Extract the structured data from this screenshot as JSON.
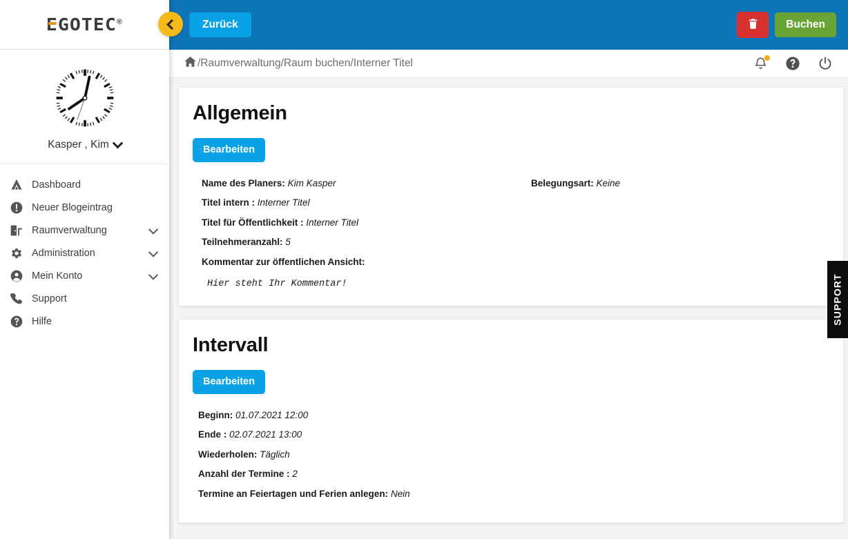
{
  "brand": {
    "logo_text": "EGOTEC",
    "logo_registered": "®",
    "accent_orange": "#e8931f",
    "header_blue": "#0e75b8",
    "button_blue": "#0aa2e6",
    "green": "#68a536",
    "red": "#d9312f",
    "yellow": "#f5ba17"
  },
  "header": {
    "back_circle_icon": "chevron-left-icon",
    "back_label": "Zurück",
    "delete_icon": "trash-icon",
    "book_label": "Buchen"
  },
  "breadcrumb": {
    "home_icon": "home-icon",
    "path": "/Raumverwaltung/Raum buchen/Interner Titel",
    "icons": [
      {
        "name": "bell-icon",
        "has_dot": true
      },
      {
        "name": "help-circle-icon",
        "has_dot": false
      },
      {
        "name": "power-icon",
        "has_dot": false
      }
    ]
  },
  "sidebar": {
    "profile": {
      "avatar_icon": "analog-clock-avatar",
      "name": "Kasper , Kim",
      "chevron_icon": "chevron-down-icon"
    },
    "items": [
      {
        "label": "Dashboard",
        "icon": "dashboard-tent-icon",
        "expandable": false
      },
      {
        "label": "Neuer Blogeintrag",
        "icon": "exclamation-circle-icon",
        "expandable": false
      },
      {
        "label": "Raumverwaltung",
        "icon": "room-door-icon",
        "expandable": true
      },
      {
        "label": "Administration",
        "icon": "gear-icon",
        "expandable": true
      },
      {
        "label": "Mein Konto",
        "icon": "user-circle-icon",
        "expandable": true
      },
      {
        "label": "Support",
        "icon": "phone-icon",
        "expandable": false
      },
      {
        "label": "Hilfe",
        "icon": "question-circle-icon",
        "expandable": false
      }
    ]
  },
  "support_tab": {
    "label": "SUPPORT"
  },
  "cards": {
    "allgemein": {
      "title": "Allgemein",
      "edit_label": "Bearbeiten",
      "left_fields": [
        {
          "label": "Name des Planers:",
          "value": "Kim Kasper"
        },
        {
          "label": "Titel intern :",
          "value": "Interner Titel"
        },
        {
          "label": "Titel für Öffentlichkeit :",
          "value": "Interner Titel"
        },
        {
          "label": "Teilnehmeranzahl:",
          "value": "5"
        }
      ],
      "comment_label": "Kommentar zur öffentlichen Ansicht:",
      "comment_value": "Hier steht Ihr Kommentar!",
      "right_fields": [
        {
          "label": "Belegungsart:",
          "value": "Keine"
        }
      ]
    },
    "intervall": {
      "title": "Intervall",
      "edit_label": "Bearbeiten",
      "fields": [
        {
          "label": "Beginn:",
          "value": "01.07.2021 12:00"
        },
        {
          "label": "Ende :",
          "value": "02.07.2021 13:00"
        },
        {
          "label": "Wiederholen:",
          "value": "Täglich"
        },
        {
          "label": "Anzahl der Termine :",
          "value": "2"
        },
        {
          "label": "Termine an Feiertagen und Ferien anlegen:",
          "value": "Nein"
        }
      ]
    }
  }
}
